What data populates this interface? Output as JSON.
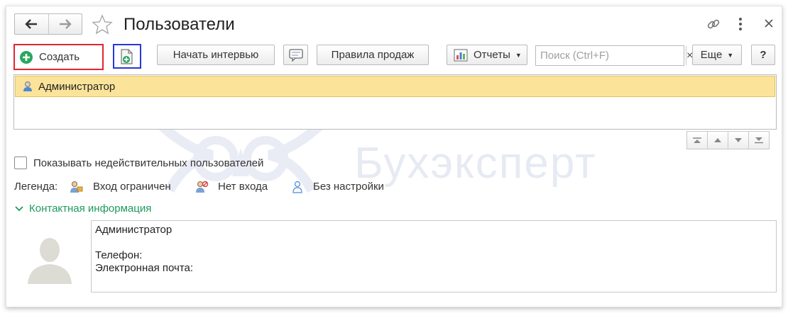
{
  "window": {
    "title": "Пользователи"
  },
  "toolbar": {
    "create_label": "Создать",
    "interview_label": "Начать интервью",
    "sales_rules_label": "Правила продаж",
    "reports_label": "Отчеты",
    "more_label": "Еще",
    "help_label": "?"
  },
  "search": {
    "placeholder": "Поиск (Ctrl+F)",
    "value": "",
    "clear": "×"
  },
  "list": {
    "rows": [
      {
        "name": "Администратор",
        "selected": true
      }
    ]
  },
  "options": {
    "show_invalid_users": "Показывать недействительных пользователей",
    "show_invalid_users_checked": false
  },
  "legend": {
    "label": "Легенда:",
    "items": [
      {
        "icon": "user-restricted-icon",
        "label": "Вход ограничен"
      },
      {
        "icon": "user-no-login-icon",
        "label": "Нет входа"
      },
      {
        "icon": "user-no-settings-icon",
        "label": "Без настройки"
      }
    ]
  },
  "contact": {
    "section_label": "Контактная информация",
    "name": "Администратор",
    "phone_label": "Телефон:",
    "email_label": "Электронная почта:"
  },
  "watermark": {
    "text": "Бухэксперт"
  },
  "colors": {
    "selected_row": "#fbe49a",
    "accent_green": "#1e9a5e",
    "highlight_red": "#e0262f",
    "highlight_blue": "#2738d8"
  }
}
